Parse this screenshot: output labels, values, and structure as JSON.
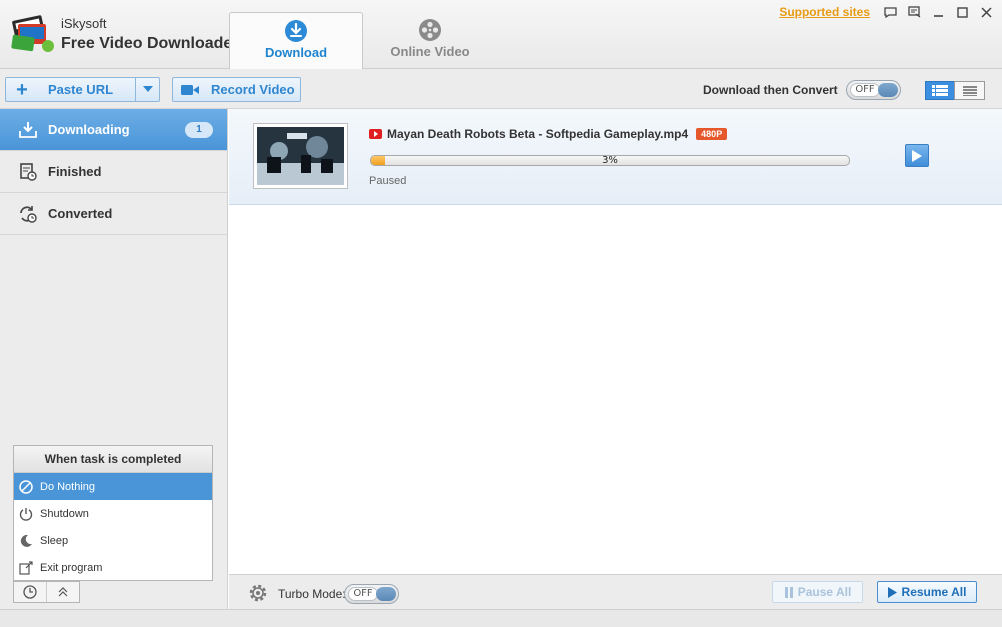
{
  "app": {
    "company": "iSkysoft",
    "product": "Free Video Downloader"
  },
  "header": {
    "tabs": [
      {
        "label": "Download",
        "icon": "download-circle-icon",
        "active": true
      },
      {
        "label": "Online Video",
        "icon": "film-reel-icon",
        "active": false
      }
    ],
    "supported_sites": "Supported sites",
    "window_controls": [
      "chat-icon",
      "feedback-icon",
      "minimize-icon",
      "maximize-icon",
      "close-icon"
    ]
  },
  "toolbar": {
    "paste_url": "Paste URL",
    "record_video": "Record Video",
    "download_then_convert": "Download then Convert",
    "convert_toggle": "OFF"
  },
  "sidebar": {
    "items": [
      {
        "label": "Downloading",
        "icon": "download-tray-icon",
        "badge": "1",
        "active": true
      },
      {
        "label": "Finished",
        "icon": "finished-doc-icon",
        "active": false
      },
      {
        "label": "Converted",
        "icon": "convert-icon",
        "active": false
      }
    ],
    "completion": {
      "title": "When task is completed",
      "options": [
        {
          "label": "Do Nothing",
          "icon": "no-entry-icon",
          "selected": true
        },
        {
          "label": "Shutdown",
          "icon": "power-icon",
          "selected": false
        },
        {
          "label": "Sleep",
          "icon": "moon-icon",
          "selected": false
        },
        {
          "label": "Exit program",
          "icon": "exit-icon",
          "selected": false
        }
      ]
    }
  },
  "downloads": [
    {
      "title": "Mayan Death Robots Beta - Softpedia Gameplay.mp4",
      "resolution": "480P",
      "progress_percent": 3,
      "progress_text": "3%",
      "status": "Paused"
    }
  ],
  "bottom": {
    "turbo_label": "Turbo Mode:",
    "turbo_toggle": "OFF",
    "pause_all": "Pause All",
    "resume_all": "Resume All"
  },
  "colors": {
    "accent": "#4a95d8",
    "progress": "#f0a020",
    "resolution_badge": "#e5582b",
    "supported_link": "#e89a12"
  }
}
